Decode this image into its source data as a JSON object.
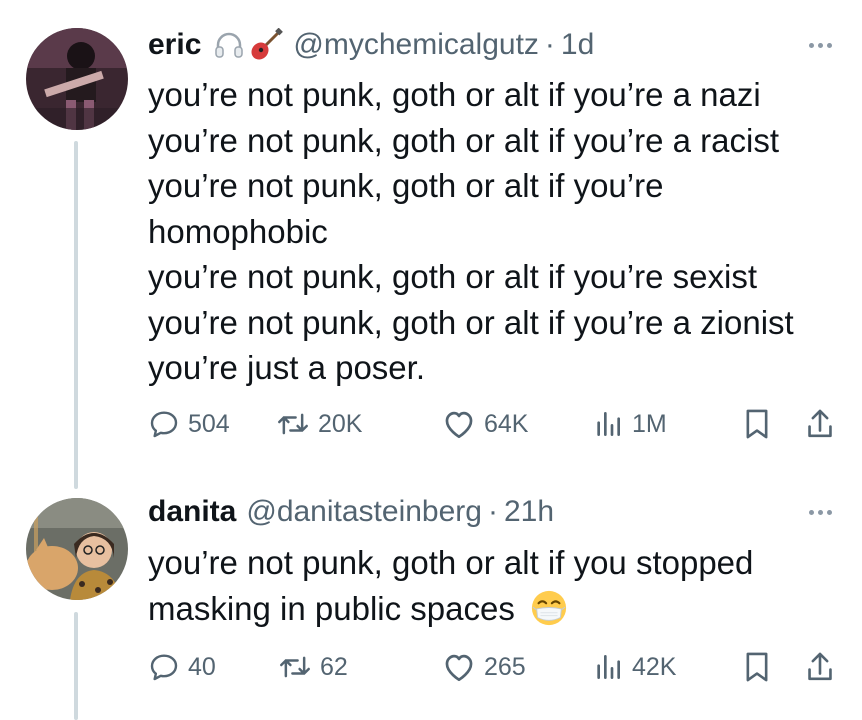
{
  "tweets": [
    {
      "name": "eric",
      "handle": "@mychemicalgutz",
      "separator": "·",
      "time": "1d",
      "badges": [
        "headphones-icon",
        "guitar-icon"
      ],
      "lines": [
        "you’re not punk, goth or alt if you’re a nazi",
        "you’re not punk, goth or alt if you’re a racist",
        "you’re not punk, goth or alt if you’re homophobic",
        "you’re not punk, goth or alt if you’re sexist",
        "you’re not punk, goth or alt if you’re a zionist",
        "you’re just a poser."
      ],
      "stats": {
        "replies": "504",
        "retweets": "20K",
        "likes": "64K",
        "views": "1M"
      }
    },
    {
      "name": "danita",
      "handle": "@danitasteinberg",
      "separator": "·",
      "time": "21h",
      "lines": [
        "you’re not punk, goth or alt if you stopped masking in public spaces"
      ],
      "emoji": "face-with-medical-mask-icon",
      "stats": {
        "replies": "40",
        "retweets": "62",
        "likes": "265",
        "views": "42K"
      }
    }
  ],
  "colors": {
    "text": "#0f1419",
    "secondary": "#536471",
    "thread_line": "#cfd9de"
  }
}
